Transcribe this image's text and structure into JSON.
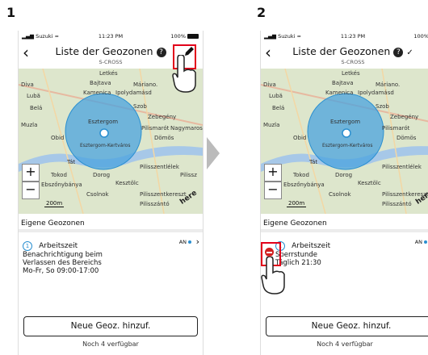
{
  "steps": [
    "1",
    "2"
  ],
  "screens": [
    {
      "status": {
        "carrier": "Suzuki",
        "time": "11:23 PM",
        "battery": "100%"
      },
      "header": {
        "title": "Liste der Geozonen",
        "subtitle": "S-CROSS"
      },
      "map": {
        "places": [
          "Letkés",
          "Diva",
          "Bajtava",
          "Máriano.",
          "Lubă",
          "Kamenica",
          "Ipolydamásd",
          "Belá",
          "Esztergom",
          "Szob",
          "Muzla",
          "Zebegény",
          "Obid",
          "Pilismarót",
          "Nagymaros",
          "Dömös",
          "Esztergom-Kertváros",
          "Tokod",
          "Dorog",
          "Pilisszentlélek",
          "Ebszőnybánya",
          "Kesztölc",
          "Csolnok",
          "Pilisszentkereszt",
          "Pilisszántó",
          "Tát",
          "Pilissz"
        ],
        "scale": "200m",
        "logo": "here"
      },
      "section_title": "Eigene Geozonen",
      "zone": {
        "index": "1",
        "name": "Arbeitszeit",
        "status": "AN",
        "desc_lines": [
          "Benachrichtigung beim",
          "Verlassen des Bereichs",
          "Mo-Fr, So 09:00-17:00"
        ]
      },
      "button": "Neue Geoz. hinzuf.",
      "available": "Noch 4 verfügbar",
      "edit_icon": "pencil-icon"
    },
    {
      "status": {
        "carrier": "Suzuki",
        "time": "11:23 PM",
        "battery": "100%"
      },
      "header": {
        "title": "Liste der Geozonen",
        "subtitle": "S-CROSS"
      },
      "section_title": "Eigene Geozonen",
      "zone": {
        "index": "1",
        "name": "Arbeitszeit",
        "status": "AN",
        "desc_lines": [
          "Sperrstunde",
          "Täglich 21:30"
        ]
      },
      "button": "Neue Geoz. hinzuf.",
      "available": "Noch 4 verfügbar",
      "delete_icon": "minus-circle-icon"
    }
  ],
  "colors": {
    "highlight": "#e2001a",
    "geofence": "#4aa3df",
    "accent": "#2a8fd0"
  }
}
